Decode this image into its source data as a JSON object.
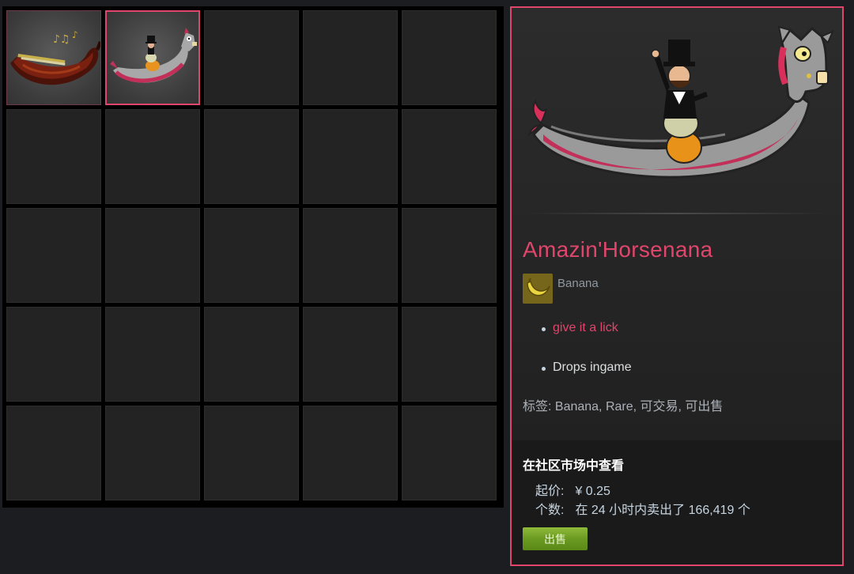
{
  "inventory": {
    "slots": [
      {
        "index": 0,
        "item": "red-banana",
        "selected": false
      },
      {
        "index": 1,
        "item": "amazin-horsenana",
        "selected": true
      }
    ],
    "total_slots": 25
  },
  "detail": {
    "item_name": "Amazin'Horsenana",
    "game_name": "Banana",
    "descriptions": [
      "give it a lick",
      "Drops ingame"
    ],
    "tags": "标签: Banana, Rare, 可交易, 可出售"
  },
  "market": {
    "title": "在社区市场中查看",
    "price_label": "起价:",
    "price_value": "¥ 0.25",
    "volume_label": "个数:",
    "volume_value": "在 24 小时内卖出了 166,419 个",
    "sell_button": "出售"
  },
  "colors": {
    "accent": "#e0466c",
    "sell_green": "#6b9a22",
    "background": "#1b1d21"
  }
}
